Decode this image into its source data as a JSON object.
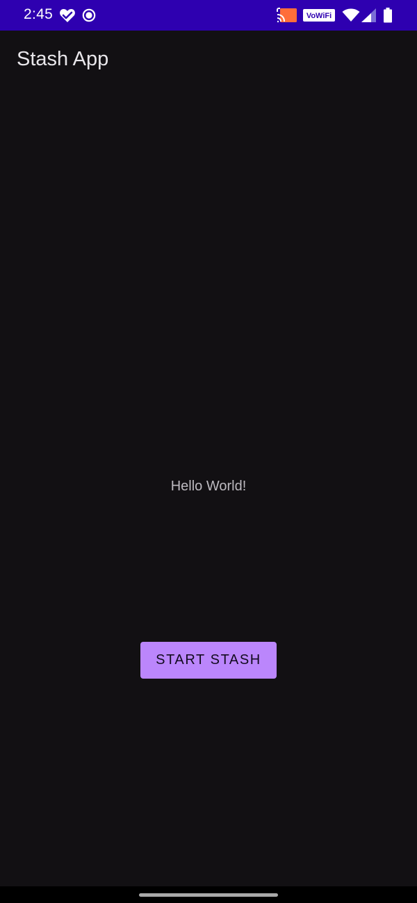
{
  "status_bar": {
    "time": "2:45",
    "vowifi_label": "VoWiFi",
    "background": "#2e00b0",
    "icons": [
      "heart-check-icon",
      "record-icon",
      "cast-icon",
      "vowifi-icon",
      "wifi-icon",
      "signal-icon",
      "battery-icon"
    ]
  },
  "app_bar": {
    "title": "Stash App"
  },
  "main": {
    "hello_text": "Hello World!",
    "start_button_label": "START STASH"
  },
  "colors": {
    "background": "#121013",
    "accent": "#bb86fc",
    "status_bar": "#2e00b0"
  }
}
